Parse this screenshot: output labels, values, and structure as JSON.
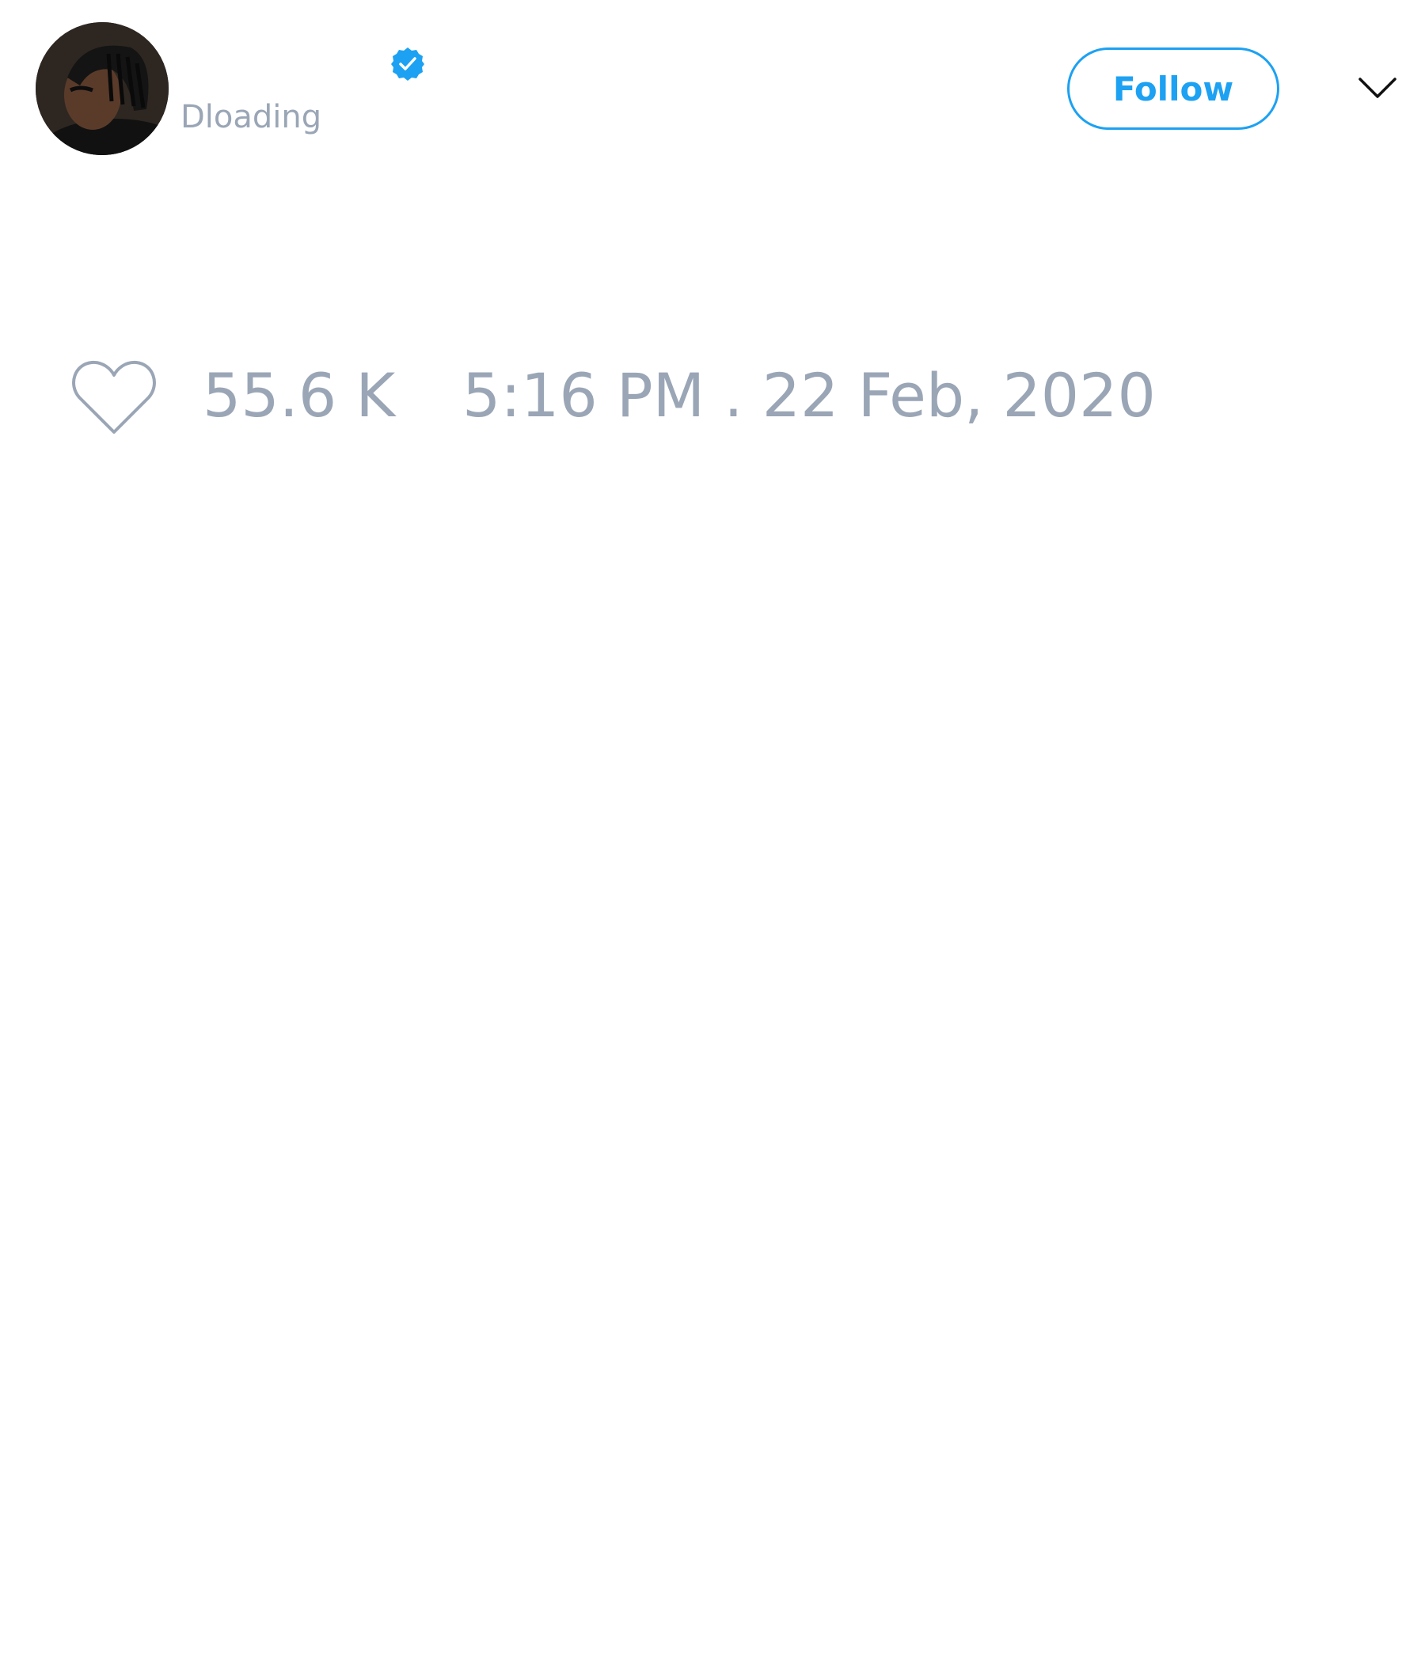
{
  "tweet": {
    "author": {
      "display_name": "",
      "handle": "Dloading",
      "verified": true,
      "avatar_icon": "profile-photo"
    },
    "follow_label": "Follow",
    "more_icon": "chevron-down-icon",
    "like_icon": "heart-icon",
    "like_count": "55.6 K",
    "timestamp": "5:16 PM . 22 Feb, 2020"
  },
  "colors": {
    "accent": "#1da1f2",
    "muted_text": "#9aa6b6",
    "background": "#ffffff",
    "chevron": "#111111"
  }
}
